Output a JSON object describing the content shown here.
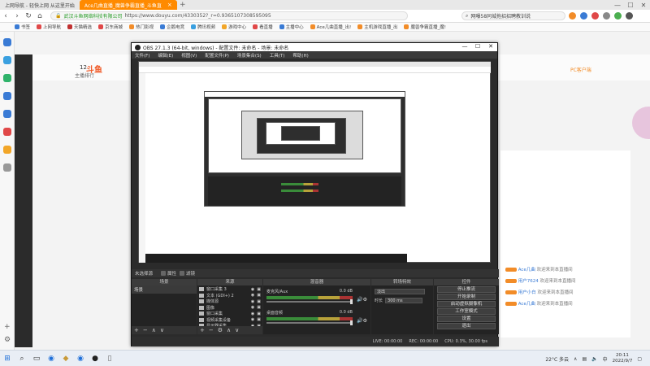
{
  "browser": {
    "tabs": [
      {
        "label": "上网导航 - 轻快上网 从这里开始",
        "active": false
      },
      {
        "label": "Ace几曲直播_魔兽争霸直播_斗鱼直",
        "active": true
      }
    ],
    "url_site": "武汉斗鱼网络科技有限公司",
    "url_path": "https://www.douyu.com/4330352?_r=0.9365107308595095",
    "search_text": "网曝58同城拖招招聘教训说",
    "bookmarks": [
      "书签",
      "上网导航",
      "天猫精选",
      "京东商城",
      "热门影视",
      "企鹅电竞",
      "腾讯视频",
      "游戏中心",
      "看直播",
      "主播中心",
      "Ace几曲直播_出!",
      "主机游戏直播_出",
      "魔兽争霸直播_魔!"
    ],
    "controls": {
      "min": "—",
      "max": "☐",
      "close": "✕",
      "back": "‹",
      "forward": "›",
      "reload": "↻",
      "home": "⌂",
      "newtab": "+",
      "menu": "⋮"
    }
  },
  "douyu": {
    "logo": "斗鱼",
    "rank_num": "12",
    "rank_label": "主播排行",
    "pc_label": "PC客户端",
    "chat": [
      {
        "name": "Ace几曲",
        "text": "欢迎来到本直播间"
      },
      {
        "name": "用户7624",
        "text": "欢迎来到本直播间"
      },
      {
        "name": "用户小白",
        "text": "欢迎来到本直播间"
      },
      {
        "name": "Ace几曲",
        "text": "欢迎来到本直播间"
      }
    ]
  },
  "obs": {
    "title": "OBS 27.1.3 (64-bit, windows) - 配置文件: 未命名 - 场景: 未命名",
    "menu": [
      "文件(F)",
      "编辑(E)",
      "视图(V)",
      "配置文件(P)",
      "场景集合(S)",
      "工具(T)",
      "帮助(H)"
    ],
    "bar_label": "未选择源",
    "bar_props": "属性",
    "bar_filters": "滤镜",
    "docks": {
      "scenes": "场景",
      "sources": "来源",
      "mixer": "混音器",
      "transitions": "转场特效",
      "controls": "控件"
    },
    "scene_items": [
      "场景"
    ],
    "sources": [
      "窗口采集 3",
      "文本 (GDI+) 2",
      "媒体源",
      "图像",
      "窗口采集",
      "视频采集设备",
      "显示器采集"
    ],
    "mixer": [
      {
        "name": "麦克风/Aux",
        "db": "0.0 dB"
      },
      {
        "name": "桌面音频",
        "db": "0.0 dB"
      }
    ],
    "transition_type": "淡出",
    "duration_label": "时长",
    "duration_value": "300 ms",
    "control_buttons": [
      "停止推流",
      "开始录制",
      "启动虚拟摄像机",
      "工作室模式",
      "设置",
      "退出"
    ],
    "status": {
      "live": "LIVE: 00:00:00",
      "rec": "REC: 00:00:00",
      "cpu": "CPU: 0.3%, 30.00 fps"
    },
    "footer_symbols": [
      "+",
      "−",
      "∧",
      "∨"
    ],
    "source_footer_symbols": [
      "+",
      "−",
      "⚙",
      "∧",
      "∨"
    ]
  },
  "taskbar": {
    "weather": "22°C 多云",
    "time": "20:11",
    "date": "2022/9/7",
    "lang": "中"
  }
}
